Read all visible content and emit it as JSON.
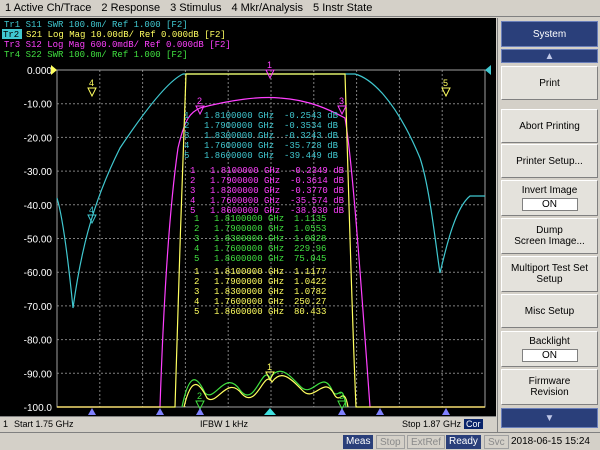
{
  "menu": [
    "1 Active Ch/Trace",
    "2 Response",
    "3 Stimulus",
    "4 Mkr/Analysis",
    "5 Instr State"
  ],
  "traces": [
    {
      "label": "Tr1  S11  SWR 100.0m/ Ref 1.000  [F2]",
      "color": "#40c8d0"
    },
    {
      "label": "S21  Log Mag 10.00dB/ Ref 0.000dB  [F2]",
      "tag": "Tr2",
      "color": "#ffff60"
    },
    {
      "label": "Tr3  S12  Log Mag 600.0mdB/ Ref 0.000dB  [F2]",
      "color": "#ff40ff"
    },
    {
      "label": "Tr4  S22  SWR 100.0m/ Ref 1.000  [F2]",
      "color": "#40e040"
    }
  ],
  "axis": {
    "y_labels": [
      "0.000",
      "-10.00",
      "-20.00",
      "-30.00",
      "-40.00",
      "-50.00",
      "-60.00",
      "-70.00",
      "-80.00",
      "-90.00",
      "-100.0"
    ],
    "y_range": [
      -100,
      0
    ],
    "x_range_ghz": [
      1.75,
      1.87
    ],
    "grid": true
  },
  "marker_tables": [
    {
      "color": "#40c8d0",
      "rows": [
        {
          "n": "1",
          "freq": "1.8100000 GHz",
          "val": "-0.2543 dB"
        },
        {
          "n": "2",
          "freq": "1.7900000 GHz",
          "val": "-0.3534 dB"
        },
        {
          "n": "3",
          "freq": "1.8300000 GHz",
          "val": "-0.3243 dB"
        },
        {
          "n": "4",
          "freq": "1.7600000 GHz",
          "val": "-35.728 dB"
        },
        {
          "n": "5",
          "freq": "1.8600000 GHz",
          "val": "-39.449 dB"
        }
      ]
    },
    {
      "color": "#ff40ff",
      "rows": [
        {
          "n": "1",
          "freq": "1.8100000 GHz",
          "val": "-0.2349 dB"
        },
        {
          "n": "2",
          "freq": "1.7900000 GHz",
          "val": "-0.3614 dB"
        },
        {
          "n": "3",
          "freq": "1.8300000 GHz",
          "val": "-0.3770 dB"
        },
        {
          "n": "4",
          "freq": "1.7600000 GHz",
          "val": "-35.574 dB"
        },
        {
          "n": "5",
          "freq": "1.8600000 GHz",
          "val": "-38.930 dB"
        }
      ]
    },
    {
      "color": "#40e040",
      "rows": [
        {
          "n": "1",
          "freq": "1.8100000 GHz",
          "val": "1.1135"
        },
        {
          "n": "2",
          "freq": "1.7900000 GHz",
          "val": "1.0553"
        },
        {
          "n": "3",
          "freq": "1.8300000 GHz",
          "val": "1.0828"
        },
        {
          "n": "4",
          "freq": "1.7600000 GHz",
          "val": "229.96"
        },
        {
          "n": "5",
          "freq": "1.8600000 GHz",
          "val": "75.045"
        }
      ]
    },
    {
      "color": "#ffff60",
      "rows": [
        {
          "n": "1",
          "freq": "1.8100000 GHz",
          "val": "1.1177"
        },
        {
          "n": "2",
          "freq": "1.7900000 GHz",
          "val": "1.0422"
        },
        {
          "n": "3",
          "freq": "1.8300000 GHz",
          "val": "1.0782"
        },
        {
          "n": "4",
          "freq": "1.7600000 GHz",
          "val": "250.27"
        },
        {
          "n": "5",
          "freq": "1.8600000 GHz",
          "val": "80.433"
        }
      ]
    }
  ],
  "status": {
    "channel": "1",
    "start": "Start 1.75 GHz",
    "ifbw": "IFBW 1 kHz",
    "stop": "Stop 1.87 GHz",
    "cor": "Cor"
  },
  "bottom": {
    "meas": "Meas",
    "stop": "Stop",
    "extref": "ExtRef",
    "ready": "Ready",
    "svc": "Svc",
    "datetime": "2018-06-15 15:24"
  },
  "softkeys": {
    "title": "System",
    "print": "Print",
    "abort": "Abort Printing",
    "printer_setup": "Printer Setup...",
    "invert_label": "Invert Image",
    "invert_value": "ON",
    "dump_line1": "Dump",
    "dump_line2": "Screen Image...",
    "multiport_line1": "Multiport Test Set",
    "multiport_line2": "Setup",
    "misc": "Misc Setup",
    "backlight_label": "Backlight",
    "backlight_value": "ON",
    "firmware_line1": "Firmware",
    "firmware_line2": "Revision"
  }
}
